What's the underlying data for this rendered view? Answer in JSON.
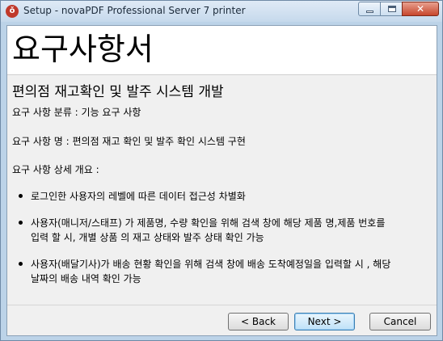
{
  "window": {
    "title": "Setup - novaPDF Professional Server 7 printer",
    "app_icon_glyph": "ǒ",
    "close_glyph": "✕"
  },
  "header": {
    "title": "요구사항서"
  },
  "content": {
    "subtitle": "편의점 재고확인 및 발주 시스템 개발",
    "category_line": "요구 사항 분류 : 기능 요구 사항",
    "name_line": "요구 사항 명 : 편의점 재고 확인 및 발주 확인 시스템 구현",
    "overview_label": "요구 사항 상세 개요 :",
    "bullets": [
      {
        "line1": "로그인한 사용자의 레벨에 따른 데이터 접근성 차별화",
        "line2": ""
      },
      {
        "line1": "사용자(매니저/스태프) 가 제품명, 수량 확인을 위해 검색 창에 해당 제품 명,제품 번호를",
        "line2": "입력 할 시, 개별 상품 의 재고 상태와 발주 상태 확인 가능"
      },
      {
        "line1": "사용자(배달기사)가 배송 현황 확인을 위해 검색 창에 배송 도착예정일을 입력할 시 , 해당",
        "line2": "날짜의 배송 내역 확인 가능"
      }
    ]
  },
  "footer": {
    "back_label": "< Back",
    "next_label": "Next >",
    "cancel_label": "Cancel"
  }
}
